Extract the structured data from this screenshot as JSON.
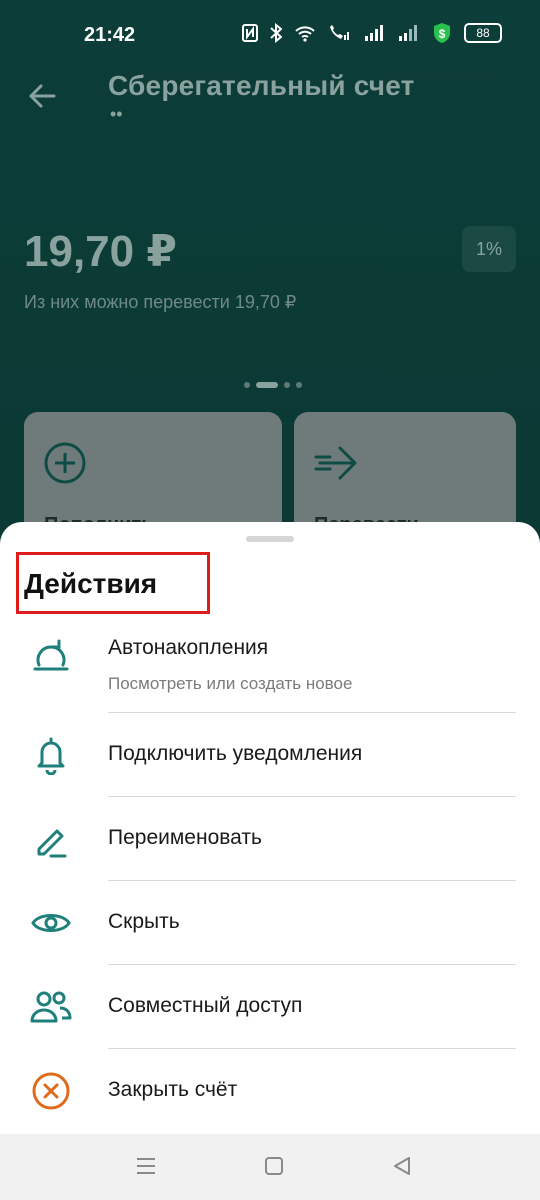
{
  "status_bar": {
    "time": "21:42",
    "battery": "88",
    "icons": [
      "nfc-icon",
      "bluetooth-icon",
      "wifi-icon",
      "call-signal-icon",
      "signal-icon",
      "signal-icon-2",
      "security-shield-icon",
      "battery-icon"
    ]
  },
  "header": {
    "title": "Сберегательный счет",
    "subtitle": "••"
  },
  "account": {
    "balance": "19,70 ₽",
    "rate": "1%",
    "transfer_note": "Из них можно перевести 19,70 ₽"
  },
  "quick_actions": [
    {
      "label": "Пополнить",
      "icon": "plus-circle-icon"
    },
    {
      "label": "Перевести",
      "icon": "arrow-right-icon"
    }
  ],
  "sheet": {
    "title": "Действия",
    "actions": [
      {
        "label": "Автонакопления",
        "sublabel": "Посмотреть или создать новое",
        "icon": "autosave-icon"
      },
      {
        "label": "Подключить уведомления",
        "icon": "bell-icon"
      },
      {
        "label": "Переименовать",
        "icon": "pencil-icon"
      },
      {
        "label": "Скрыть",
        "icon": "eye-icon"
      },
      {
        "label": "Совместный доступ",
        "icon": "users-icon"
      },
      {
        "label": "Закрыть счёт",
        "icon": "close-circle-icon"
      }
    ]
  },
  "colors": {
    "accent": "#1f7f7a",
    "danger": "#e06a1b",
    "highlight_box": "#e01b1b"
  }
}
